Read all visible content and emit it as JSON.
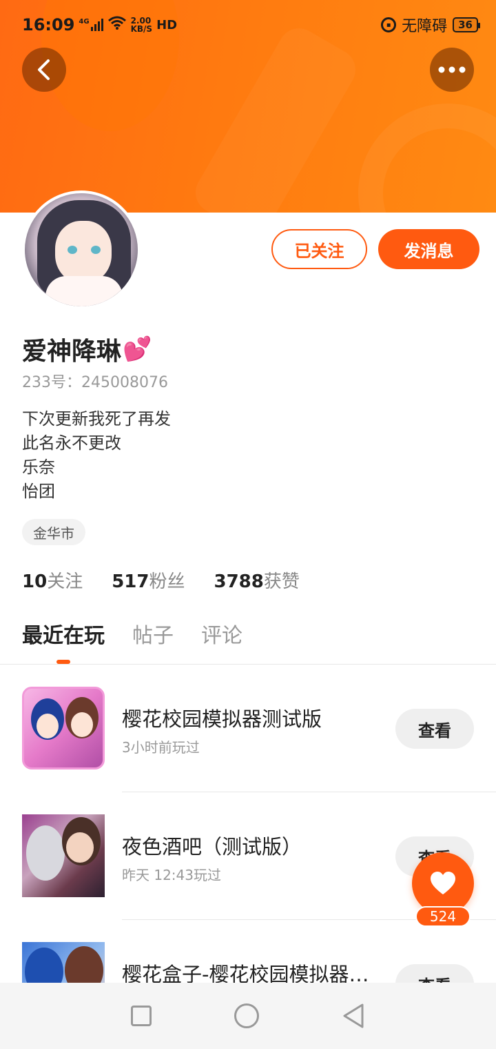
{
  "status_bar": {
    "time": "16:09",
    "network": "4G",
    "speed_value": "2.00",
    "speed_unit": "KB/S",
    "hd": "HD",
    "accessibility": "无障碍",
    "battery": "36"
  },
  "profile": {
    "username": "爱神降琳",
    "username_emoji": "💕",
    "uid": "233号：245008076",
    "bio": [
      "下次更新我死了再发",
      "此名永不更改",
      "乐奈",
      "怡团"
    ],
    "location": "金华市",
    "follow_button": "已关注",
    "message_button": "发消息"
  },
  "stats": [
    {
      "value": "10",
      "label": "关注"
    },
    {
      "value": "517",
      "label": "粉丝"
    },
    {
      "value": "3788",
      "label": "获赞"
    }
  ],
  "tabs": [
    {
      "label": "最近在玩",
      "active": true
    },
    {
      "label": "帖子",
      "active": false
    },
    {
      "label": "评论",
      "active": false
    }
  ],
  "games": [
    {
      "title": "樱花校园模拟器测试版",
      "subtitle": "3小时前玩过",
      "button": "查看"
    },
    {
      "title": "夜色酒吧（测试版）",
      "subtitle": "昨天 12:43玩过",
      "button": "查看"
    },
    {
      "title": "樱花盒子-樱花校园模拟器…",
      "subtitle": "",
      "button": "查看"
    }
  ],
  "like": {
    "count": "524"
  },
  "colors": {
    "accent": "#ff5a10",
    "header": "#ff7a10"
  }
}
